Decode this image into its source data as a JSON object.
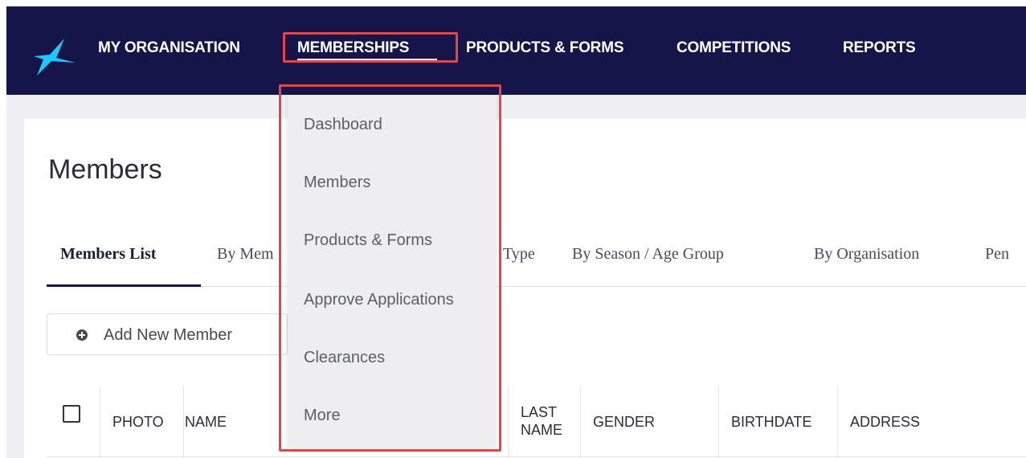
{
  "colors": {
    "nav_bg": "#15154a",
    "logo": "#1ec8ff",
    "highlight": "#e8434b",
    "dropdown_bg": "#eeeef0"
  },
  "topnav": {
    "items": [
      {
        "label": "MY ORGANISATION"
      },
      {
        "label": "MEMBERSHIPS",
        "active": true
      },
      {
        "label": "PRODUCTS & FORMS"
      },
      {
        "label": "COMPETITIONS"
      },
      {
        "label": "REPORTS"
      }
    ]
  },
  "dropdown": {
    "items": [
      {
        "label": "Dashboard"
      },
      {
        "label": "Members"
      },
      {
        "label": "Products & Forms"
      },
      {
        "label": "Approve Applications"
      },
      {
        "label": "Clearances"
      },
      {
        "label": "More"
      }
    ]
  },
  "page": {
    "title": "Members"
  },
  "tabs": [
    {
      "label": "Members List",
      "active": true
    },
    {
      "label": "By Mem"
    },
    {
      "label": "Type"
    },
    {
      "label": "By Season / Age Group"
    },
    {
      "label": "By Organisation"
    },
    {
      "label": "Pen"
    }
  ],
  "actions": {
    "add_member_label": "Add New Member"
  },
  "table": {
    "columns": [
      {
        "label": "PHOTO"
      },
      {
        "label": "NAME"
      },
      {
        "label": "LAST NAME"
      },
      {
        "label": "GENDER"
      },
      {
        "label": "BIRTHDATE"
      },
      {
        "label": "ADDRESS"
      }
    ]
  }
}
